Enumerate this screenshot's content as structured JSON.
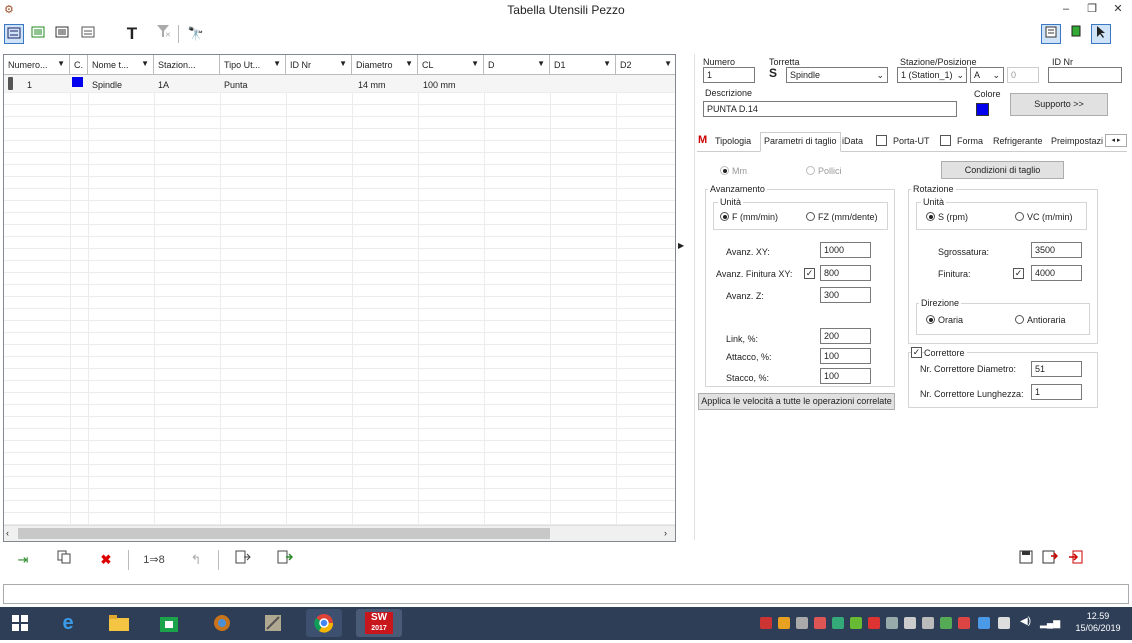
{
  "window": {
    "title": "Tabella Utensili Pezzo",
    "minimize": "–",
    "restore": "❐",
    "close": "✕"
  },
  "toolbar": {
    "text_glyph": "T",
    "binocular_glyph": "🔭"
  },
  "grid": {
    "columns": [
      "Numero...",
      "C.",
      "Nome t...",
      "Stazion...",
      "Tipo Ut...",
      "ID Nr",
      "Diametro",
      "CL",
      "D",
      "D1",
      "D2"
    ],
    "row": {
      "numero": "1",
      "color": "#0000ee",
      "nome": "Spindle",
      "stazione": "1A",
      "tipo": "Punta",
      "diametro": "14 mm",
      "cl": "100 mm"
    }
  },
  "form": {
    "numero_label": "Numero",
    "numero_value": "1",
    "torretta_label": "Torretta",
    "torretta_value": "Spindle",
    "stazione_label": "Stazione/Posizione",
    "stazione_value": "1 (Station_1)",
    "posizione_value": "A",
    "posizione_num": "0",
    "idnr_label": "ID Nr",
    "idnr_value": "",
    "descrizione_label": "Descrizione",
    "descrizione_value": "PUNTA D.14",
    "colore_label": "Colore",
    "colore_value": "#0000ee",
    "supporto_button": "Supporto >>"
  },
  "tabs": [
    "Tipologia",
    "Parametri di taglio",
    "iData",
    "Porta-UT",
    "Forma",
    "Refrigerante",
    "Preimpostazio"
  ],
  "params": {
    "mm_label": "Mm",
    "pollici_label": "Pollici",
    "condizioni_button": "Condizioni di taglio",
    "avanzamento_title": "Avanzamento",
    "unita_label": "Unità",
    "f_label": "F (mm/min)",
    "fz_label": "FZ (mm/dente)",
    "avanz_xy_label": "Avanz. XY:",
    "avanz_xy_value": "1000",
    "avanz_finitura_label": "Avanz. Finitura XY:",
    "avanz_finitura_value": "800",
    "avanz_z_label": "Avanz. Z:",
    "avanz_z_value": "300",
    "link_label": "Link, %:",
    "link_value": "200",
    "attacco_label": "Attacco, %:",
    "attacco_value": "100",
    "stacco_label": "Stacco, %:",
    "stacco_value": "100",
    "applica_button": "Applica le velocità a tutte le operazioni correlate",
    "rotazione_title": "Rotazione",
    "unita2_label": "Unità",
    "s_label": "S (rpm)",
    "vc_label": "VC (m/min)",
    "sgrossatura_label": "Sgrossatura:",
    "sgrossatura_value": "3500",
    "finitura_label": "Finitura:",
    "finitura_value": "4000",
    "direzione_title": "Direzione",
    "oraria_label": "Oraria",
    "antioraria_label": "Antioraria",
    "correttore_label": "Correttore",
    "corr_diam_label": "Nr. Correttore Diametro:",
    "corr_diam_value": "51",
    "corr_lung_label": "Nr. Correttore Lunghezza:",
    "corr_lung_value": "1"
  },
  "taskbar": {
    "time": "12.59",
    "date": "15/06/2019",
    "sw_label": "SW",
    "sw_year": "2017"
  }
}
